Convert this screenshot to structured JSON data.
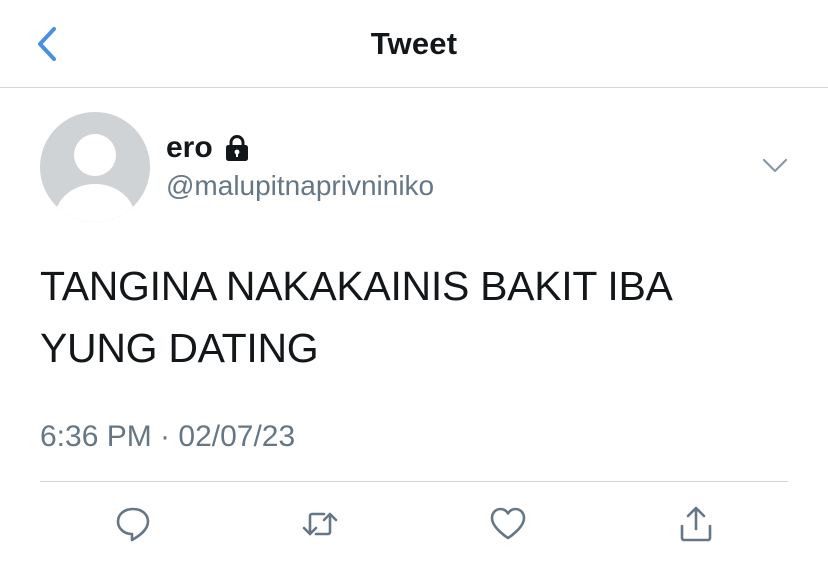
{
  "header": {
    "title": "Tweet",
    "back_icon": "chevron-left-icon"
  },
  "tweet": {
    "author": {
      "display_name": "ero",
      "username": "@malupitnaprivniniko",
      "protected_icon": "lock-icon",
      "avatar_icon": "default-avatar-icon"
    },
    "text_line_1": "TANGINA NAKAKAINIS BAKIT IBA",
    "text_line_2": "YUNG DATING",
    "timestamp": "6:36 PM · 02/07/23",
    "menu_icon": "chevron-down-icon"
  },
  "actions": [
    {
      "icon": "reply-icon"
    },
    {
      "icon": "retweet-icon"
    },
    {
      "icon": "like-icon"
    },
    {
      "icon": "share-icon"
    }
  ],
  "colors": {
    "accent": "#4a90e2",
    "text": "#14171a",
    "secondary_text": "#657786",
    "divider": "#cfd6dc",
    "avatar_bg": "#cfd3d6",
    "icon_gray": "#657786"
  }
}
